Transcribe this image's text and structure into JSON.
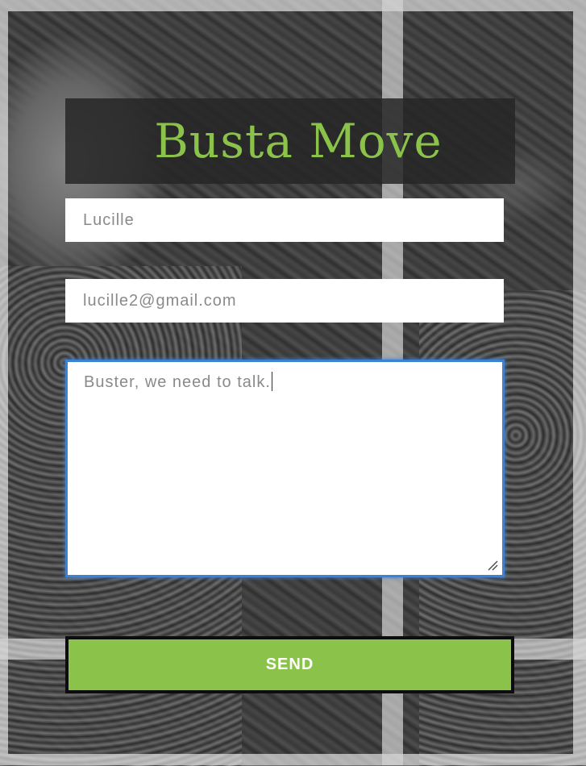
{
  "form": {
    "title": "Busta Move",
    "name_value": "Lucille",
    "email_value": "lucille2@gmail.com",
    "message_value": "Buster, we need to talk.",
    "send_label": "SEND"
  },
  "colors": {
    "accent": "#8bc34a",
    "button_border": "#0d0d0d",
    "focus_ring": "#3b82d6",
    "title_box": "#262626"
  },
  "icons": {
    "textarea_resize": "resize-grip-icon"
  }
}
